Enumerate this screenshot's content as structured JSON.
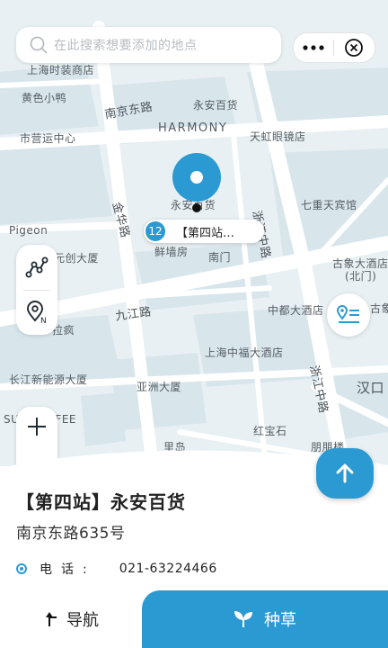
{
  "search": {
    "placeholder": "在此搜索想要添加的地点"
  },
  "map": {
    "labels": {
      "shanghai_fashion": "上海时装商店",
      "yellow_duck": "黄色小鸭",
      "nanjing_east_top": "南京东路",
      "yongan_top": "永安百货",
      "harmony": "HARMONY",
      "municipal_center": "市营运中心",
      "tianhong": "天虹眼镜店",
      "yongan_under_pin": "永安百货",
      "zhejiang_road_top": "浙江中路",
      "qichong": "七重天宾馆",
      "jinhua": "金华路",
      "pigeon": "Pigeon",
      "yuanchuang": "元创大厦",
      "xianqiang": "鲜墙房",
      "nanmen": "南门",
      "guxiang": "古象大酒店",
      "beimen": "(北门)",
      "jiujiang": "九江路",
      "zhongdu": "中都大酒店",
      "guxiang_cut": "古象",
      "lafeng": "拉疯",
      "zhongfu": "上海中福大酒店",
      "changjiang": "长江新能源大厦",
      "yazhou": "亚洲大厦",
      "zhejiang_road_bottom": "浙江中路",
      "hankou": "汉口",
      "sun_coffee": "SUN COFFEE",
      "hongbaoshi": "红宝石",
      "lidao": "里岛",
      "pengpeng": "朋朋楼"
    }
  },
  "marker": {
    "badge": "12",
    "callout": "【第四站…"
  },
  "place": {
    "title": "【第四站】永安百货",
    "address": "南京东路635号",
    "phone_label": "电话:",
    "phone_value": "021-63224466"
  },
  "actions": {
    "navigate": "导航",
    "seed": "种草"
  },
  "colors": {
    "accent": "#2b9ad2"
  },
  "icons": [
    "search-icon",
    "more-icon",
    "close-circle-icon",
    "route-icon",
    "location-north-icon",
    "zoom-in-icon",
    "list-card-icon",
    "arrow-up-icon",
    "turn-arrow-icon",
    "sprout-icon"
  ]
}
